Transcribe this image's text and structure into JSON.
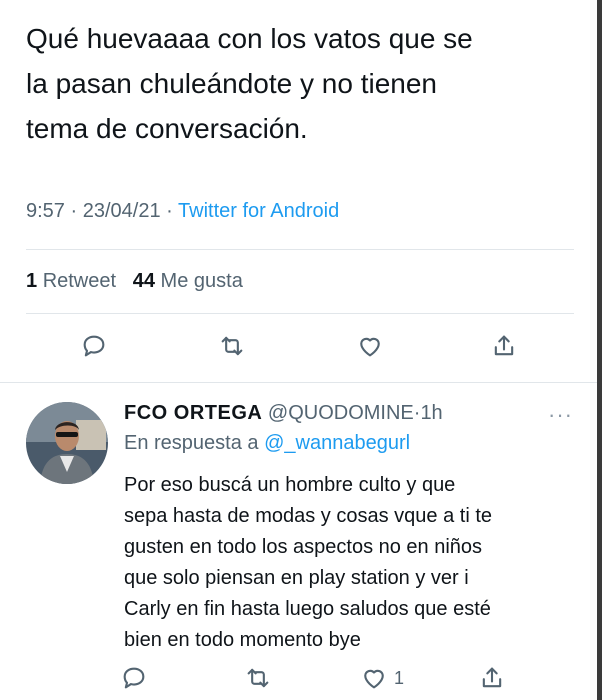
{
  "tweet": {
    "text": "Qué huevaaaa con los vatos que se\nla pasan chuleándote y no tienen\ntema de conversación.",
    "time": "9:57",
    "date": "23/04/21",
    "separator": "·",
    "source": "Twitter for Android",
    "retweets_count": "1",
    "retweets_label": "Retweet",
    "likes_count": "44",
    "likes_label": "Me gusta"
  },
  "actions": {
    "reply_icon": "speech-bubble",
    "retweet_icon": "retweet-arrows",
    "like_icon": "heart",
    "share_icon": "share-upload"
  },
  "reply": {
    "name": "FCO  ORTEGA",
    "handle": "@QUODOMINE",
    "time": "1h",
    "separator": "·",
    "more": "···",
    "reply_prefix": "En respuesta a",
    "reply_mention": "@_wannabegurl",
    "text": "Por eso buscá un hombre culto y que\nsepa hasta de modas y cosas vque a ti te\ngusten en todo los aspectos no en niños\nque solo piensan en play station y ver i\nCarly en fin hasta luego saludos que esté\nbien en todo momento bye",
    "like_count": "1"
  },
  "colors": {
    "text": "#0f1419",
    "secondary": "#536471",
    "link": "#1d9bf0",
    "divider": "#e1e6ea"
  }
}
